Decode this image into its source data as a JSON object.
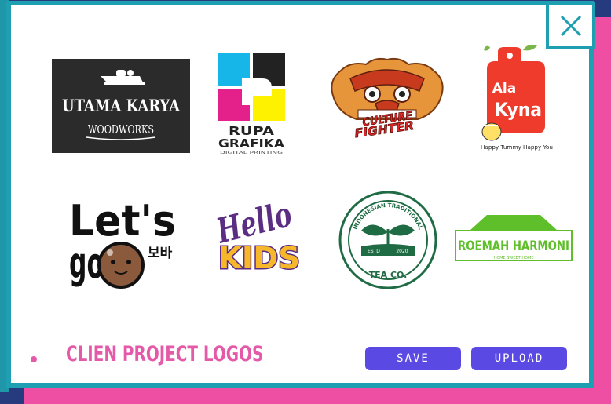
{
  "window": {
    "close_icon": "close-icon",
    "accent_color": "#1f9fb2",
    "frame_color": "#ef4fa2"
  },
  "logos": [
    {
      "id": "utama",
      "line1": "UTAMA KARYA",
      "line2": "WOODWORKS"
    },
    {
      "id": "rupa",
      "line1": "RUPA",
      "line2": "GRAFIKA",
      "line3": "DIGITAL PRINTING"
    },
    {
      "id": "culture",
      "line1": "CULTURE",
      "line2": "FIGHTER"
    },
    {
      "id": "alakyna",
      "line1": "Ala",
      "line2": "Kyna",
      "tagline": "Happy Tummy Happy You"
    },
    {
      "id": "letsgo",
      "line1": "Let's",
      "line2": "go",
      "korean": "보바"
    },
    {
      "id": "hellokids",
      "line1": "Hello",
      "line2": "KIDS"
    },
    {
      "id": "teaco",
      "ring_text": "INDONESIAN TRADITIONAL",
      "estd": "ESTD",
      "year": "2020",
      "name": "TEA CO."
    },
    {
      "id": "roemah",
      "name": "ROEMAH HARMONI",
      "tagline": "HOME SWEET HOME"
    }
  ],
  "footer": {
    "title": "CLIEN PROJECT LOGOS",
    "save_label": "SAVE",
    "upload_label": "UPLOAD",
    "button_color": "#5a4ae3",
    "title_color": "#e55aa8"
  }
}
